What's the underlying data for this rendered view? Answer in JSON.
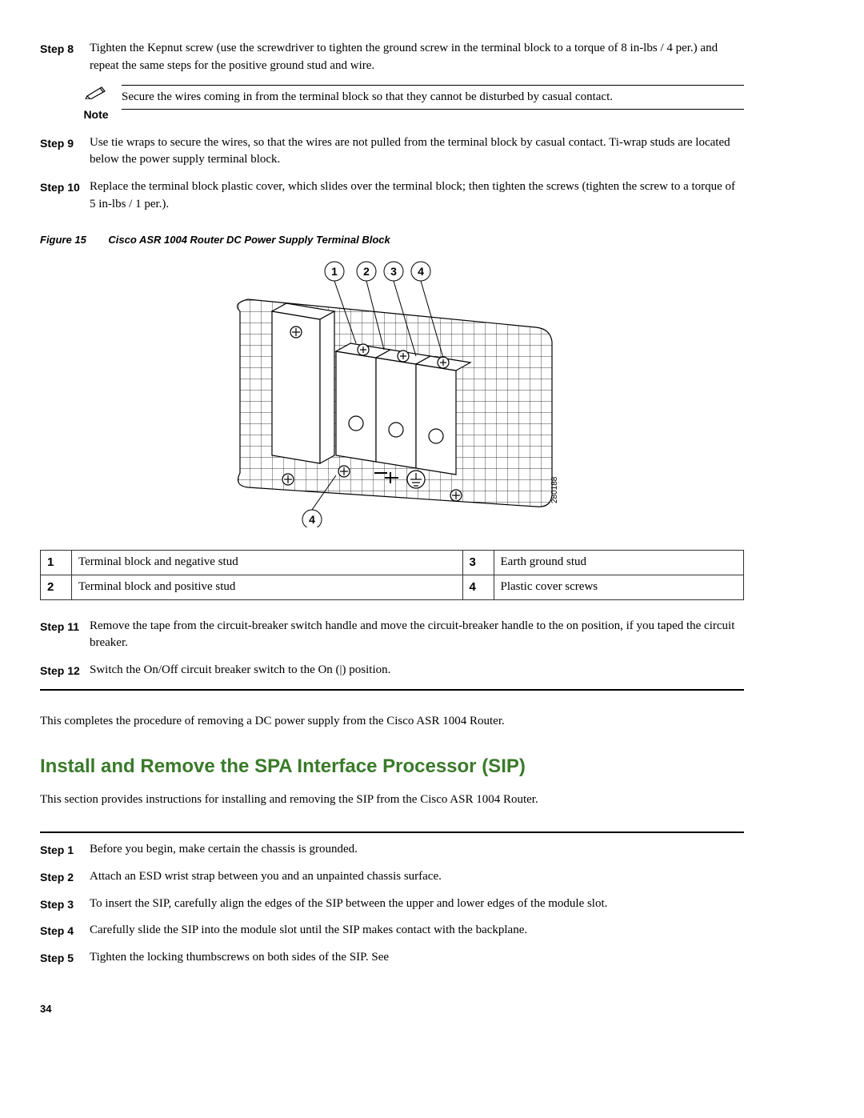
{
  "steps_a": [
    {
      "n": "Step 8",
      "text": "Tighten the Kepnut screw (use the screwdriver to tighten the ground screw in the terminal block to a torque of 8 in-lbs / 4 per.) and repeat the same steps for the positive ground stud and wire."
    }
  ],
  "note": {
    "label": "Note",
    "text": "Secure the wires coming in from the terminal block so that they cannot be disturbed by casual contact."
  },
  "steps_b": [
    {
      "n": "Step 9",
      "text": "Use tie wraps to secure the wires, so that the wires are not pulled from the terminal block by casual contact. Ti-wrap studs are located below the power supply terminal block."
    },
    {
      "n": "Step 10",
      "text": "Replace the terminal block plastic cover, which slides over the terminal block; then tighten the screws (tighten the screw to a torque of 5 in-lbs / 1 per.)."
    }
  ],
  "figure": {
    "label": "Figure 15",
    "title": "Cisco ASR 1004 Router DC Power Supply Terminal Block",
    "callouts": {
      "c1": "1",
      "c2": "2",
      "c3": "3",
      "c4": "4",
      "c4b": "4"
    },
    "image_id": "280188"
  },
  "legend": {
    "r1n1": "1",
    "r1t1": "Terminal block and negative stud",
    "r1n2": "3",
    "r1t2": "Earth ground stud",
    "r2n1": "2",
    "r2t1": "Terminal block and positive stud",
    "r2n2": "4",
    "r2t2": "Plastic cover screws"
  },
  "steps_c": [
    {
      "n": "Step 11",
      "text": "Remove the tape from the circuit-breaker switch handle and move the circuit-breaker handle to the on position, if you taped the circuit breaker."
    },
    {
      "n": "Step 12",
      "text": "Switch the On/Off circuit breaker switch to the On (|) position."
    }
  ],
  "closing": "This completes the procedure of removing a DC power supply from the Cisco ASR 1004 Router.",
  "section": {
    "title": "Install and Remove the SPA Interface Processor (SIP)",
    "intro": "This section provides instructions for installing and removing the SIP from the Cisco ASR 1004 Router."
  },
  "steps_d": [
    {
      "n": "Step 1",
      "text": "Before you begin, make certain the chassis is grounded."
    },
    {
      "n": "Step 2",
      "text": "Attach an ESD wrist strap between you and an unpainted chassis surface."
    },
    {
      "n": "Step 3",
      "text": "To insert the SIP, carefully align the edges of the SIP between the upper and lower edges of the module slot."
    },
    {
      "n": "Step 4",
      "text": "Carefully slide the SIP into the module slot until the SIP makes contact with the backplane."
    },
    {
      "n": "Step 5",
      "text": "Tighten the locking thumbscrews on both sides of the SIP. See"
    }
  ],
  "page_number": "34"
}
